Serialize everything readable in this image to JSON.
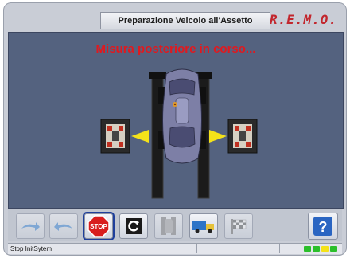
{
  "header": {
    "title": "Preparazione Veicolo all'Assetto",
    "logo_text": "R.E.M.O."
  },
  "main": {
    "status_message": "Misura posteriore in corso..."
  },
  "toolbar": {
    "buttons": [
      {
        "name": "forward-arrow",
        "state": "disabled"
      },
      {
        "name": "back-arrow",
        "state": "disabled"
      },
      {
        "name": "stop",
        "label": "STOP",
        "state": "active"
      },
      {
        "name": "refresh",
        "state": "normal"
      },
      {
        "name": "car-setup",
        "state": "disabled"
      },
      {
        "name": "truck",
        "state": "normal"
      },
      {
        "name": "checkered-flag",
        "state": "disabled"
      }
    ],
    "help_label": "?"
  },
  "statusbar": {
    "left_text": "Stop InitSytem"
  },
  "colors": {
    "accent_red": "#e0191f",
    "logo_red": "#c2262d",
    "scene_bg": "#54627f",
    "sensor_yellow": "#f4e21a"
  }
}
